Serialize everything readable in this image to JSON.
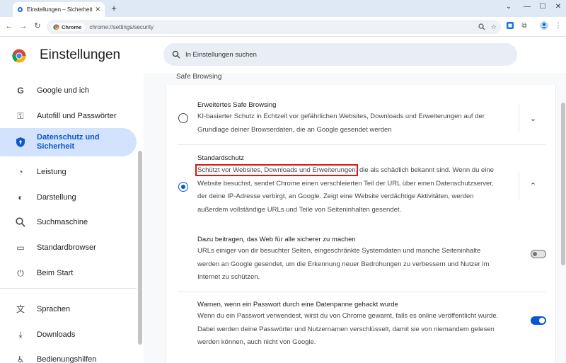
{
  "browser": {
    "tab_title": "Einstellungen – Sicherheit",
    "tab_close": "✕",
    "new_tab": "+",
    "window_controls": {
      "chevron": "⌄",
      "minimize": "—",
      "maximize": "☐",
      "close": "✕"
    },
    "nav": {
      "back": "←",
      "forward": "→",
      "reload": "↻"
    },
    "site_chip": "Chrome",
    "url": "chrome://settings/security"
  },
  "header": {
    "title": "Einstellungen",
    "search_placeholder": "In Einstellungen suchen"
  },
  "sidebar": {
    "items": [
      {
        "label": "Google und ich",
        "icon": "google-g-icon",
        "glyph": "G"
      },
      {
        "label": "Autofill und Passwörter",
        "icon": "key-icon",
        "glyph": "⚿"
      },
      {
        "label": "Datenschutz und Sicherheit",
        "icon": "shield-icon",
        "glyph": "⛉",
        "active": true
      },
      {
        "label": "Leistung",
        "icon": "speedometer-icon",
        "glyph": "◔"
      },
      {
        "label": "Darstellung",
        "icon": "palette-icon",
        "glyph": "◐"
      },
      {
        "label": "Suchmaschine",
        "icon": "search-icon",
        "glyph": "⌕"
      },
      {
        "label": "Standardbrowser",
        "icon": "browser-icon",
        "glyph": "▭"
      },
      {
        "label": "Beim Start",
        "icon": "power-icon",
        "glyph": "⏻"
      },
      {
        "label": "Sprachen",
        "icon": "translate-icon",
        "glyph": "文"
      },
      {
        "label": "Downloads",
        "icon": "download-icon",
        "glyph": "⤓"
      },
      {
        "label": "Bedienungshilfen",
        "icon": "accessibility-icon",
        "glyph": "♿"
      }
    ]
  },
  "main": {
    "section_title": "Safe Browsing",
    "enhanced": {
      "title": "Erweitertes Safe Browsing",
      "description": "KI-basierter Schutz in Echtzeit vor gefährlichen Websites, Downloads und Erweiterungen auf der Grundlage deiner Browserdaten, die an Google gesendet werden",
      "selected": false,
      "expander": "⌄"
    },
    "standard": {
      "title": "Standardschutz",
      "description_highlight": "Schützt vor Websites, Downloads und Erweiterungen",
      "description_rest": ", die als schädlich bekannt sind. Wenn du eine Website besuchst, sendet Chrome einen verschleierten Teil der URL über einen Datenschutzserver, der deine IP-Adresse verbirgt, an Google. Zeigt eine Website verdächtige Aktivitäten, werden außerdem vollständige URLs und Teile von Seiteninhalten gesendet.",
      "selected": true,
      "expander": "⌃"
    },
    "help_improve": {
      "title": "Dazu beitragen, das Web für alle sicherer zu machen",
      "description": "URLs einiger von dir besuchter Seiten, eingeschränkte Systemdaten und manche Seiteninhalte werden an Google gesendet, um die Erkennung neuer Bedrohungen zu verbessern und Nutzer im Internet zu schützen.",
      "enabled": false
    },
    "password_leak": {
      "title": "Warnen, wenn ein Passwort durch eine Datenpanne gehackt wurde",
      "description": "Wenn du ein Passwort verwendest, wirst du von Chrome gewarnt, falls es online veröffentlicht wurde. Dabei werden deine Passwörter und Nutzernamen verschlüsselt, damit sie von niemandem gelesen werden können, auch nicht von Google.",
      "enabled": true
    }
  },
  "colors": {
    "accent": "#0b57d0",
    "active_nav_bg": "#d3e3fd",
    "highlight_box": "#e01515"
  }
}
